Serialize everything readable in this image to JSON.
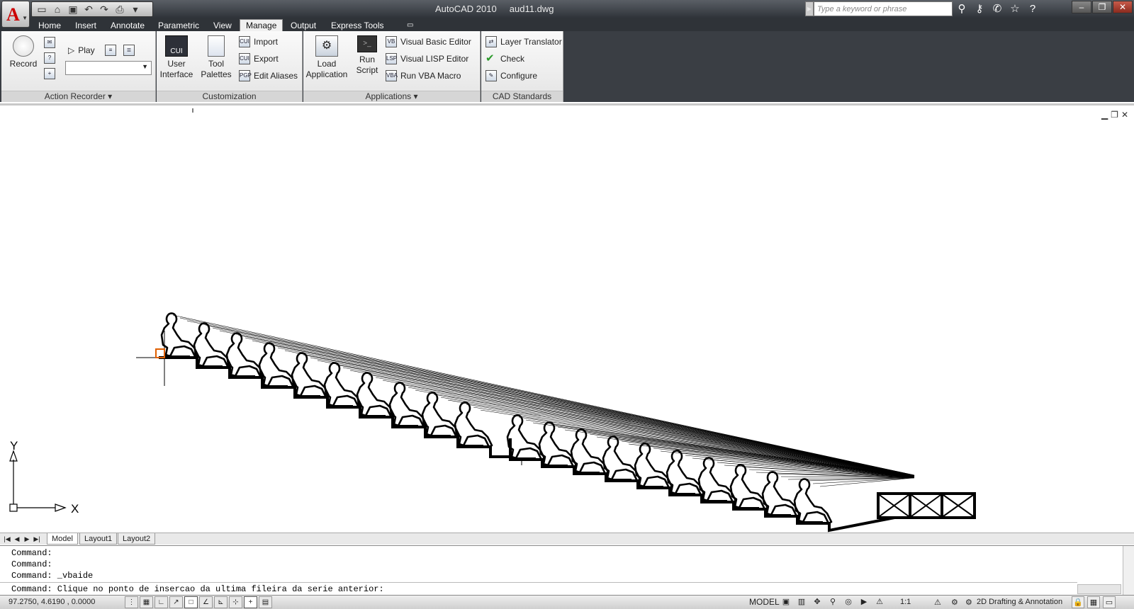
{
  "app": {
    "product": "AutoCAD 2010",
    "file": "aud11.dwg",
    "search_placeholder": "Type a keyword or phrase"
  },
  "ribbon_tabs": [
    "Home",
    "Insert",
    "Annotate",
    "Parametric",
    "View",
    "Manage",
    "Output",
    "Express Tools"
  ],
  "active_tab": "Manage",
  "panels": {
    "action_recorder": {
      "title": "Action Recorder",
      "record": "Record",
      "play": "Play"
    },
    "customization": {
      "title": "Customization",
      "user_interface": [
        "User",
        "Interface"
      ],
      "tool_palettes": [
        "Tool",
        "Palettes"
      ],
      "import": "Import",
      "export": "Export",
      "edit_aliases": "Edit Aliases"
    },
    "applications": {
      "title": "Applications",
      "load_application": [
        "Load",
        "Application"
      ],
      "run_script": [
        "Run",
        "Script"
      ],
      "visual_basic_editor": "Visual Basic Editor",
      "visual_lisp_editor": "Visual LISP Editor",
      "run_vba_macro": "Run VBA Macro"
    },
    "cad_standards": {
      "title": "CAD Standards",
      "layer_translator": "Layer Translator",
      "check": "Check",
      "configure": "Configure"
    }
  },
  "ucs": {
    "x_label": "X",
    "y_label": "Y"
  },
  "layout_tabs": [
    "Model",
    "Layout1",
    "Layout2"
  ],
  "command_lines": [
    "Command:",
    "Command:",
    "Command: _vbaide"
  ],
  "command_prompt": "Command: Clique no ponto de insercao da ultima fileira da serie anterior:",
  "status": {
    "coords": "97.2750, 4.6190 , 0.0000",
    "model": "MODEL",
    "scale": "1:1",
    "workspace": "2D Drafting & Annotation"
  },
  "colors": {
    "title_bar": "#3a3e44",
    "ribbon_panel": "#ececec",
    "drawing_line": "#000000",
    "cursor_box": "#e06000"
  },
  "icons": {
    "app_button": "autocad-a-icon",
    "viewport_controls": [
      "minimize-icon",
      "restore-icon",
      "close-icon"
    ]
  }
}
